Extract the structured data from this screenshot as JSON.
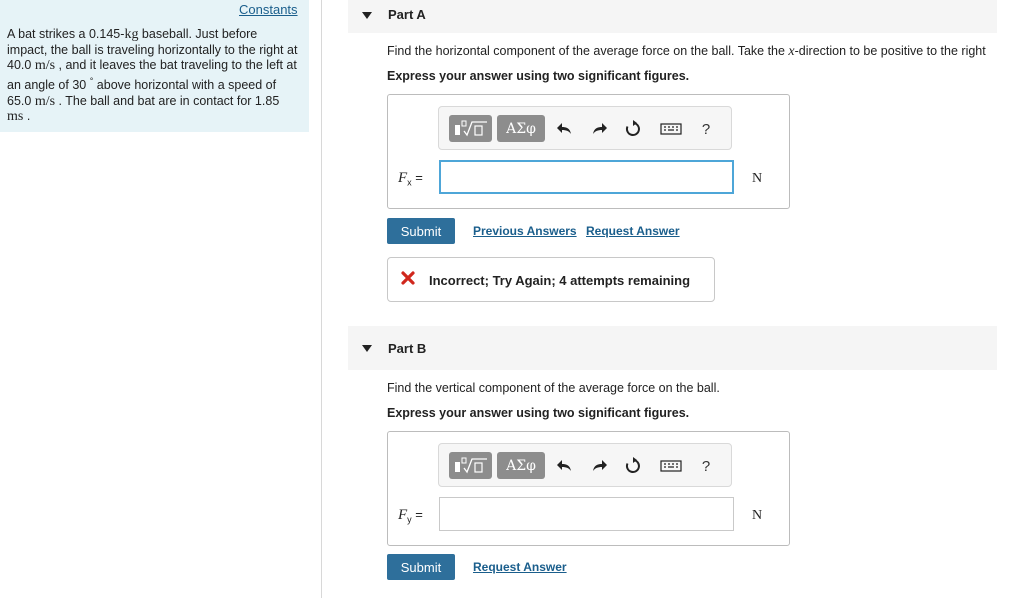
{
  "problem": {
    "constants_label": "Constants",
    "segments": [
      {
        "t": "A bat strikes a 0.145-"
      },
      {
        "t": "kg",
        "m": true
      },
      {
        "t": " baseball. Just before impact, the ball is traveling horizontally to the right at 40.0 "
      },
      {
        "t": "m/s",
        "m": true
      },
      {
        "t": " , and it leaves the bat traveling to the left at an angle of 30 "
      },
      {
        "t": "°",
        "sup": true
      },
      {
        "t": "  above horizontal with a speed of 65.0 "
      },
      {
        "t": "m/s",
        "m": true
      },
      {
        "t": " . The ball and bat are in contact for 1.85 "
      },
      {
        "t": "ms",
        "m": true
      },
      {
        "t": " ."
      }
    ]
  },
  "partA": {
    "title": "Part A",
    "question_pre": "Find the horizontal component of the average force on the ball. Take the ",
    "question_var": "x",
    "question_post": "-direction to be positive to the right",
    "instruction": "Express your answer using two significant figures.",
    "toolbar_greek": "ΑΣφ",
    "help": "?",
    "var_symbol": "F",
    "var_sub": "x",
    "equals": "=",
    "answer_value": "",
    "unit": "N",
    "submit_label": "Submit",
    "previous_label": "Previous Answers",
    "request_label": "Request Answer",
    "feedback": "Incorrect; Try Again; 4 attempts remaining"
  },
  "partB": {
    "title": "Part B",
    "question": "Find the vertical component of the average force on the ball.",
    "instruction": "Express your answer using two significant figures.",
    "toolbar_greek": "ΑΣφ",
    "help": "?",
    "var_symbol": "F",
    "var_sub": "y",
    "equals": "=",
    "answer_value": "",
    "unit": "N",
    "submit_label": "Submit",
    "request_label": "Request Answer"
  },
  "colors": {
    "panel_bg": "#e6f3f7",
    "submit_bg": "#2e6f9b",
    "link": "#1a5e8c",
    "error": "#d0271d",
    "focus": "#4ea6d8"
  }
}
